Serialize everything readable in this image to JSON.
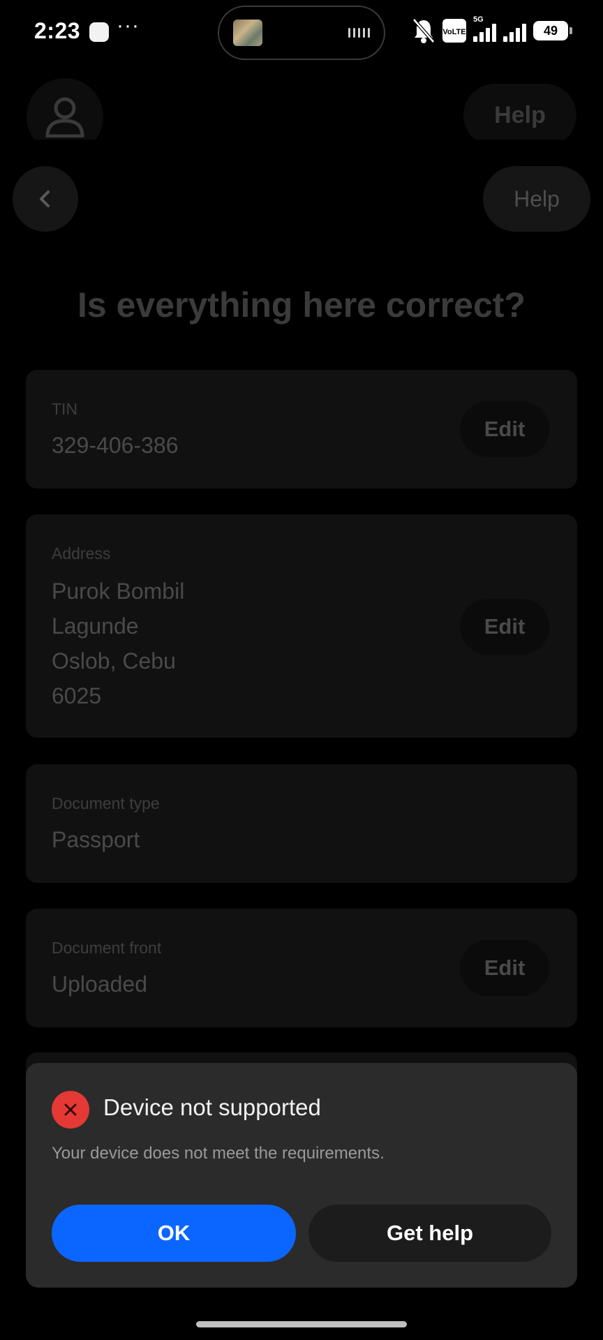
{
  "status_bar": {
    "time": "2:23",
    "more": "···",
    "network": "5G",
    "volte_line1": "Vo",
    "volte_line2": "LTE",
    "battery": "49"
  },
  "header": {
    "top_help_label": "Help",
    "help_label": "Help"
  },
  "page": {
    "title": "Is everything here correct?"
  },
  "cards": {
    "tin": {
      "label": "TIN",
      "value": "329-406-386",
      "edit_label": "Edit"
    },
    "address": {
      "label": "Address",
      "lines": [
        "Purok Bombil",
        "Lagunde",
        "Oslob, Cebu",
        "6025"
      ],
      "edit_label": "Edit"
    },
    "document_type": {
      "label": "Document type",
      "value": "Passport"
    },
    "document_front": {
      "label": "Document front",
      "value": "Uploaded",
      "edit_label": "Edit"
    }
  },
  "dialog": {
    "title": "Device not supported",
    "message": "Your device does not meet the requirements.",
    "ok_label": "OK",
    "get_help_label": "Get help"
  },
  "colors": {
    "primary_button": "#0b66ff",
    "error": "#e53935",
    "sheet_bg": "#2b2b2b"
  }
}
